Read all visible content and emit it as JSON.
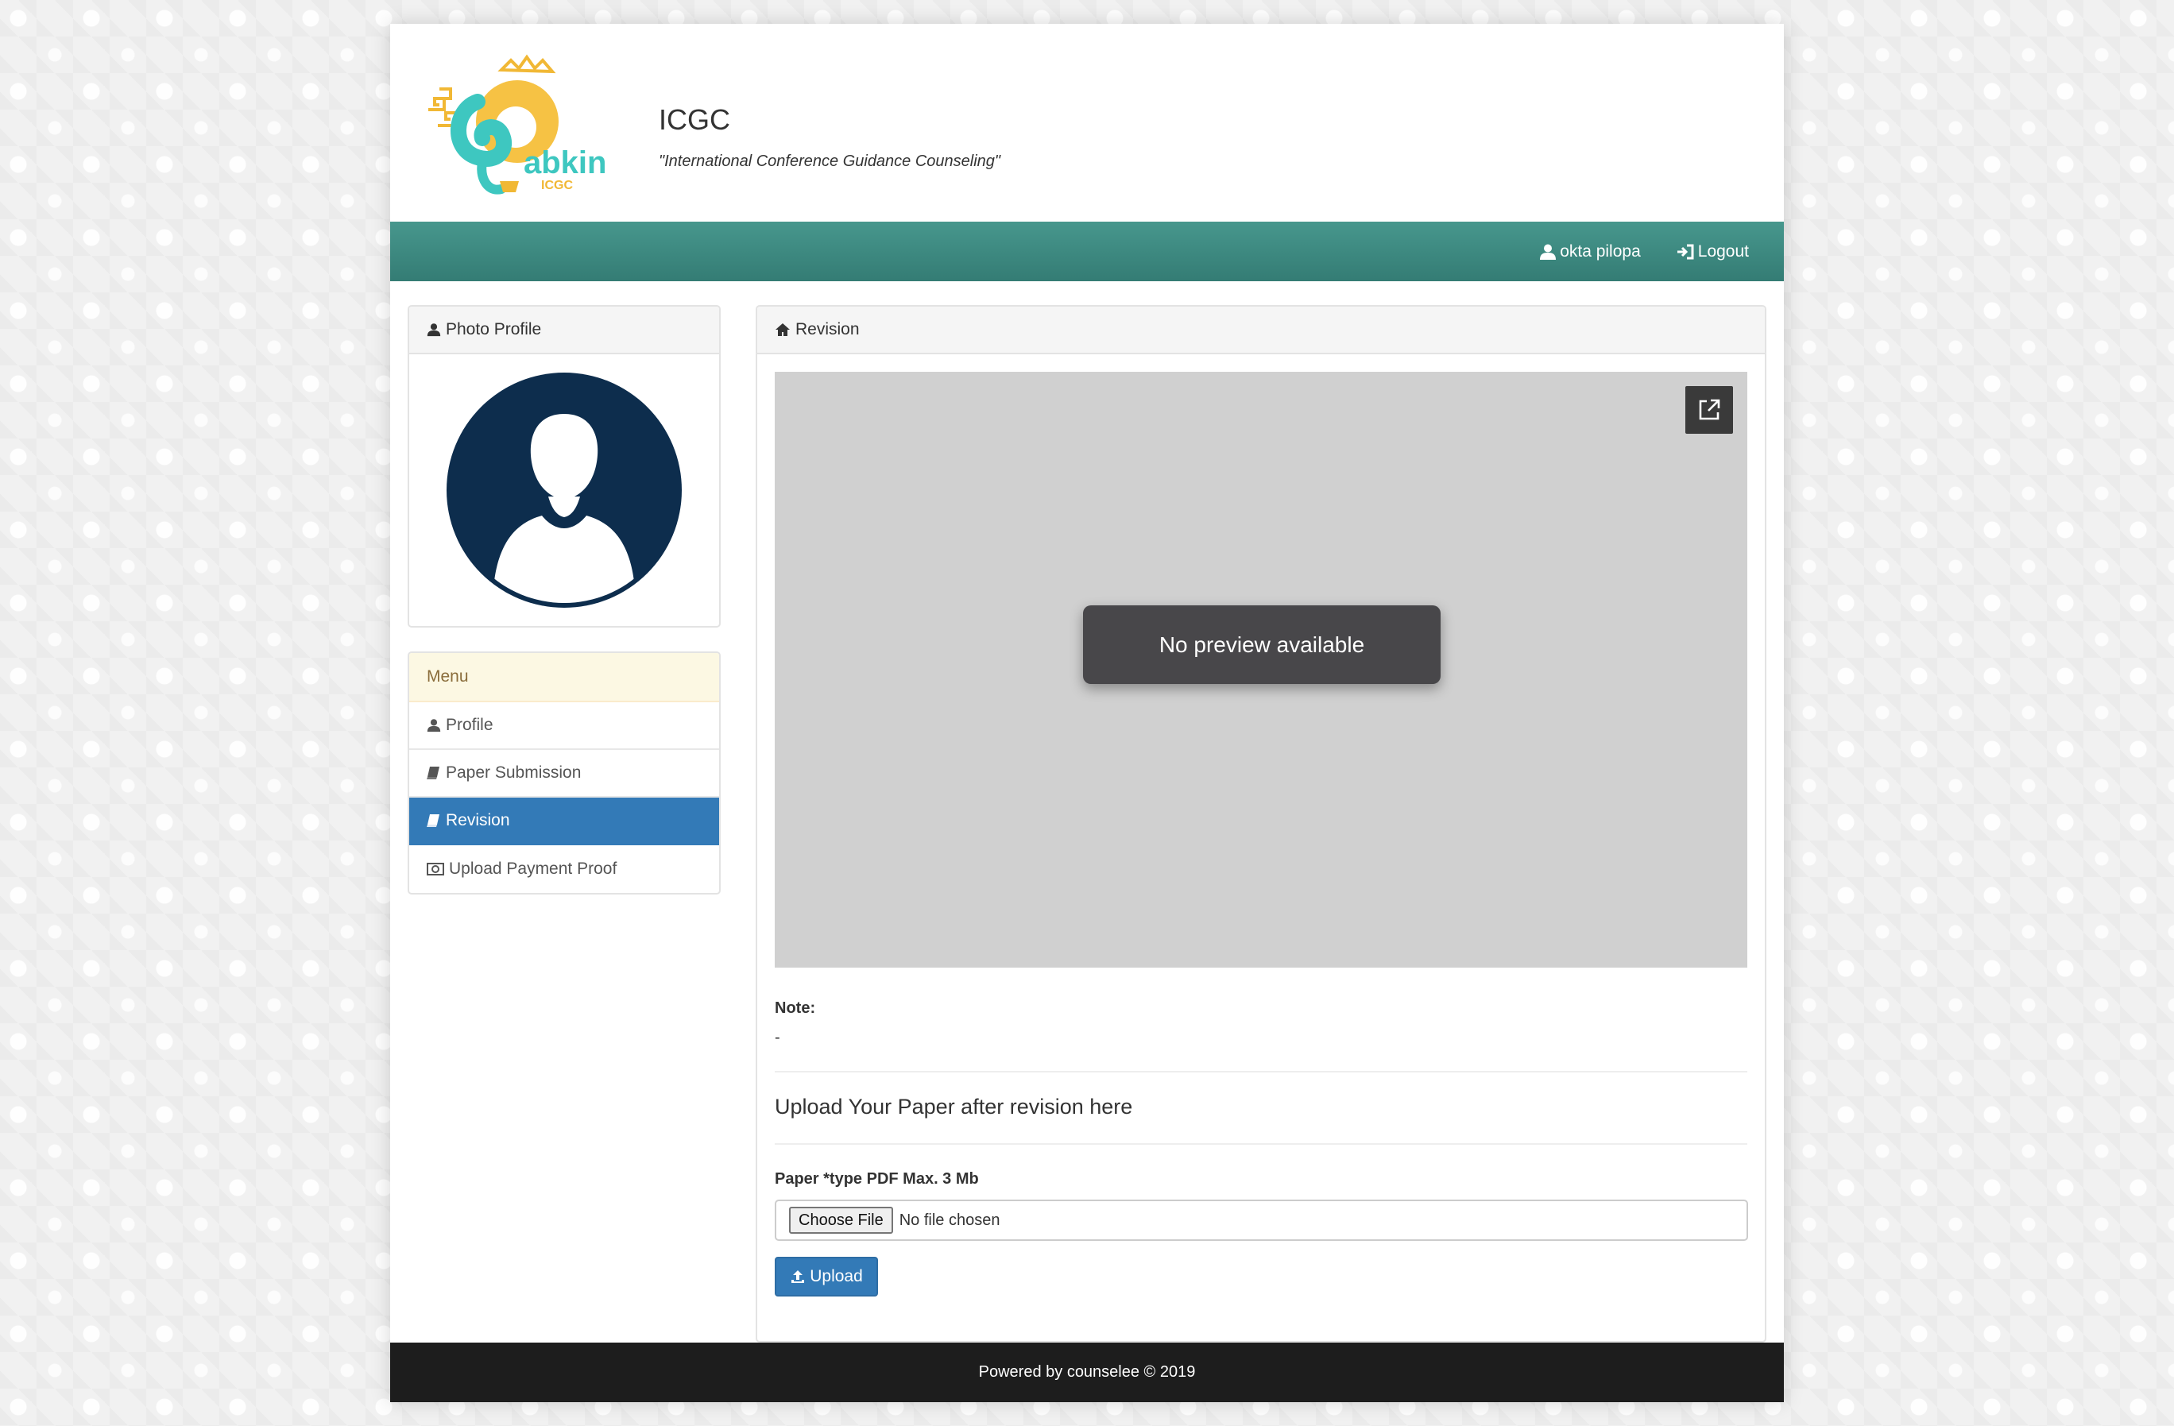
{
  "header": {
    "title": "ICGC",
    "tagline": "\"International Conference Guidance Counseling\"",
    "logo_text": "abkin",
    "logo_subtext": "ICGC"
  },
  "navbar": {
    "user_label": "okta pilopa",
    "logout_label": "Logout"
  },
  "sidebar": {
    "photo_heading": "Photo Profile",
    "menu_heading": "Menu",
    "items": [
      {
        "label": "Profile",
        "icon": "user-icon"
      },
      {
        "label": "Paper Submission",
        "icon": "book-icon"
      },
      {
        "label": "Revision",
        "icon": "book-icon",
        "active": true
      },
      {
        "label": "Upload Payment Proof",
        "icon": "money-icon"
      }
    ]
  },
  "main": {
    "heading": "Revision",
    "preview_message": "No preview available",
    "note_label": "Note:",
    "note_value": "-",
    "upload_title": "Upload Your Paper after revision here",
    "field_label": "Paper *type PDF Max. 3 Mb",
    "choose_file_label": "Choose File",
    "no_file_text": "No file chosen",
    "upload_button": "Upload"
  },
  "footer": {
    "text": "Powered by counselee © 2019"
  },
  "colors": {
    "navbar": "#3d8a80",
    "primary": "#337ab7",
    "menu_heading_bg": "#fcf8e3",
    "avatar": "#0d2d4d",
    "footer": "#1d1d1d"
  }
}
